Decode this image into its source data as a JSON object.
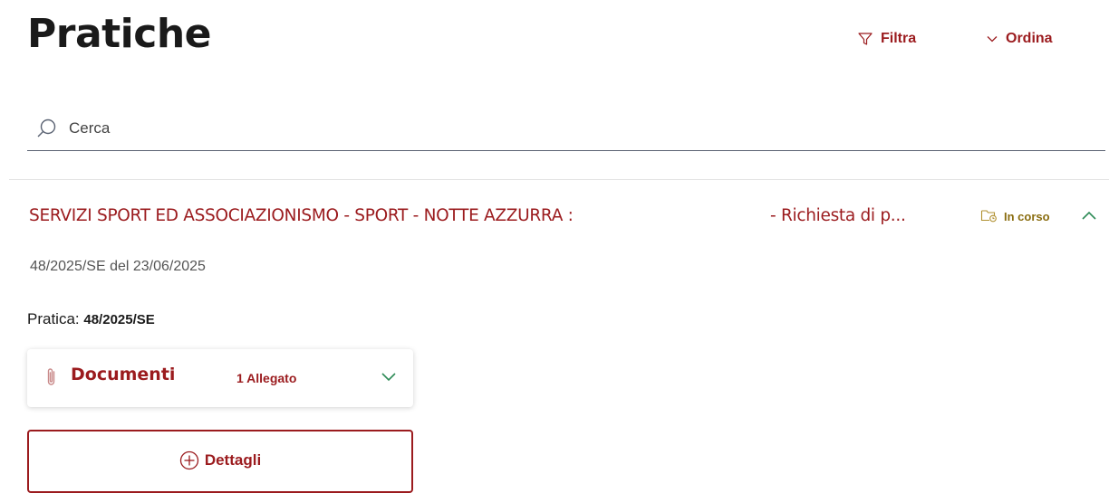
{
  "header": {
    "title": "Pratiche",
    "filter_label": "Filtra",
    "order_label": "Ordina"
  },
  "search": {
    "placeholder": "Cerca",
    "value": ""
  },
  "case": {
    "title_part1": "SERVIZI SPORT ED ASSOCIAZIONISMO - SPORT - NOTTE AZZURRA :",
    "title_part2": "- Richiesta di p...",
    "status": "In corso",
    "subtitle": "48/2025/SE del 23/06/2025",
    "pratica_label": "Pratica:",
    "pratica_value": "48/2025/SE",
    "documents": {
      "label": "Documenti",
      "attachments": "1 Allegato"
    },
    "details_label": "Dettagli"
  },
  "colors": {
    "accent": "#9b1b1e",
    "status": "#8a6d10",
    "chevron_green": "#2e8b57"
  },
  "icons": {
    "filter": "filter-icon",
    "order": "chevron-down-icon",
    "search": "search-icon",
    "status": "folder-status-icon",
    "collapse": "chevron-up-icon",
    "clip": "paperclip-icon",
    "docs_toggle": "chevron-down-icon",
    "details": "plus-circle-icon"
  }
}
